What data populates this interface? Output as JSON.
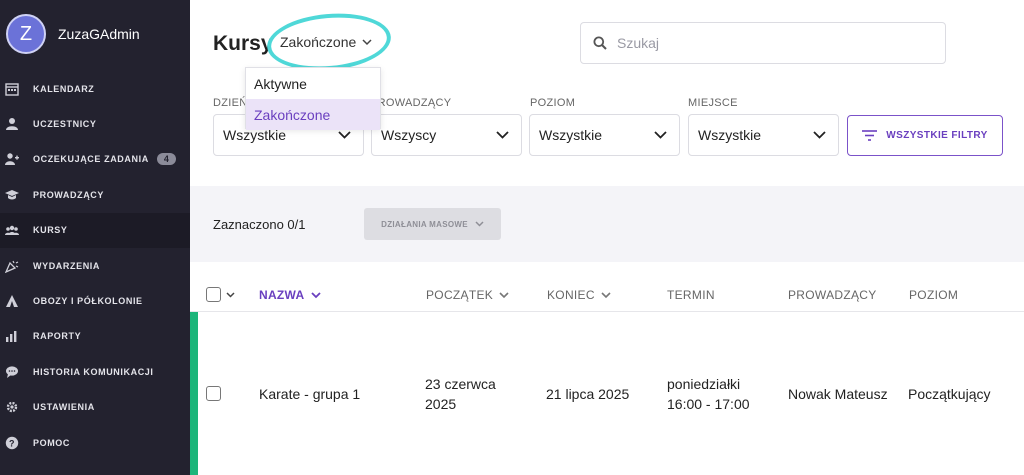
{
  "app": {
    "user_name": "ZuzaGAdmin",
    "avatar_initial": "Z"
  },
  "sidebar": {
    "items": [
      {
        "label": "KALENDARZ",
        "icon": "calendar-icon"
      },
      {
        "label": "UCZESTNICY",
        "icon": "user-icon"
      },
      {
        "label": "OCZEKUJĄCE ZADANIA",
        "icon": "user-plus-icon",
        "badge": "4"
      },
      {
        "label": "PROWADZĄCY",
        "icon": "graduation-cap-icon"
      },
      {
        "label": "KURSY",
        "icon": "group-icon",
        "active": true
      },
      {
        "label": "WYDARZENIA",
        "icon": "party-icon"
      },
      {
        "label": "OBOZY I PÓŁKOLONIE",
        "icon": "tent-icon"
      },
      {
        "label": "RAPORTY",
        "icon": "chart-icon"
      },
      {
        "label": "HISTORIA KOMUNIKACJI",
        "icon": "chat-icon"
      },
      {
        "label": "USTAWIENIA",
        "icon": "gear-icon"
      },
      {
        "label": "POMOC",
        "icon": "help-icon"
      }
    ]
  },
  "header": {
    "title": "Kursy",
    "status_selected": "Zakończone",
    "search_placeholder": "Szukaj"
  },
  "status_dropdown": {
    "options": [
      {
        "label": "Aktywne",
        "selected": false
      },
      {
        "label": "Zakończone",
        "selected": true
      }
    ]
  },
  "filters": {
    "items": [
      {
        "label": "DZIEŃ",
        "value": "Wszystkie"
      },
      {
        "label": "PROWADZĄCY",
        "value": "Wszyscy"
      },
      {
        "label": "POZIOM",
        "value": "Wszystkie"
      },
      {
        "label": "MIEJSCE",
        "value": "Wszystkie"
      }
    ],
    "all_filters_label": "WSZYSTKIE FILTRY"
  },
  "bulk": {
    "selected_text": "Zaznaczono 0/1",
    "actions_label": "DZIAŁANIA MASOWE"
  },
  "table": {
    "columns": [
      "NAZWA",
      "POCZĄTEK",
      "KONIEC",
      "TERMIN",
      "PROWADZĄCY",
      "POZIOM"
    ],
    "rows": [
      {
        "name": "Karate - grupa 1",
        "start_line1": "23 czerwca",
        "start_line2": "2025",
        "end": "21 lipca 2025",
        "term_line1": "poniedziałki",
        "term_line2": "16:00 - 17:00",
        "instructor": "Nowak Mateusz",
        "level": "Początkujący"
      }
    ]
  },
  "colors": {
    "sidebar_bg": "#23222f",
    "accent_purple": "#6a3fbf",
    "highlight_circle": "#4fd8d8",
    "row_accent_green": "#1cb57a"
  }
}
